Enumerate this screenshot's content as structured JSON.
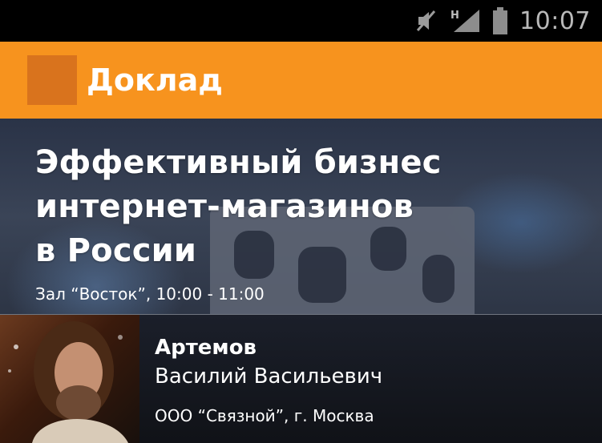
{
  "status_bar": {
    "time": "10:07",
    "network_label": "H",
    "icons": [
      "mute-icon",
      "signal-icon",
      "battery-icon"
    ]
  },
  "action_bar": {
    "title": "Доклад",
    "color": "#f7931e",
    "icon_color": "#d9731d"
  },
  "talk": {
    "title_lines": [
      "Эффективный бизнес",
      "интернет-магазинов",
      "в России"
    ],
    "meta": "Зал “Восток”, 10:00 - 11:00"
  },
  "speaker": {
    "last_name": "Артемов",
    "first_names": "Василий Васильевич",
    "company": "ООО “Связной”, г. Москва",
    "photo": "speaker-photo"
  }
}
